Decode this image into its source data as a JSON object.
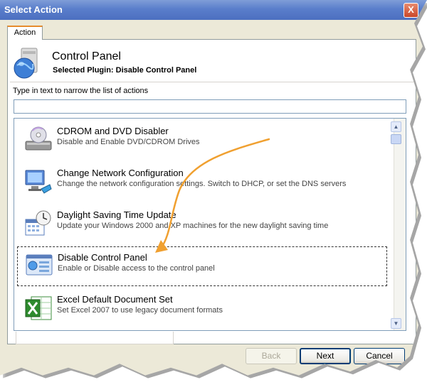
{
  "window": {
    "title": "Select Action",
    "close_label": "X"
  },
  "tab": {
    "label": "Action"
  },
  "header": {
    "title": "Control Panel",
    "subtitle": "Selected Plugin: Disable Control Panel"
  },
  "filter": {
    "label": "Type in text to narrow the list of actions",
    "value": "",
    "placeholder": ""
  },
  "actions": [
    {
      "title": "CDROM and DVD Disabler",
      "description": "Disable and Enable DVD/CDROM Drives",
      "icon": "cdrom-drive-icon"
    },
    {
      "title": "Change Network Configuration",
      "description": "Change the network configuration settings. Switch to DHCP, or set the DNS servers",
      "icon": "network-computer-icon"
    },
    {
      "title": "Daylight Saving Time Update",
      "description": "Update your Windows 2000 and XP machines for the new daylight saving time",
      "icon": "calendar-clock-icon"
    },
    {
      "title": "Disable Control Panel",
      "description": "Enable or Disable access to the control panel",
      "icon": "control-panel-icon",
      "selected": true
    },
    {
      "title": "Excel Default Document Set",
      "description": "Set Excel 2007 to use legacy document formats",
      "icon": "excel-icon"
    }
  ],
  "buttons": {
    "back": "Back",
    "next": "Next",
    "cancel": "Cancel"
  },
  "colors": {
    "titlebar": "#5A7ECB",
    "arrow": "#F0A030",
    "tab_accent": "#E68B2C"
  }
}
